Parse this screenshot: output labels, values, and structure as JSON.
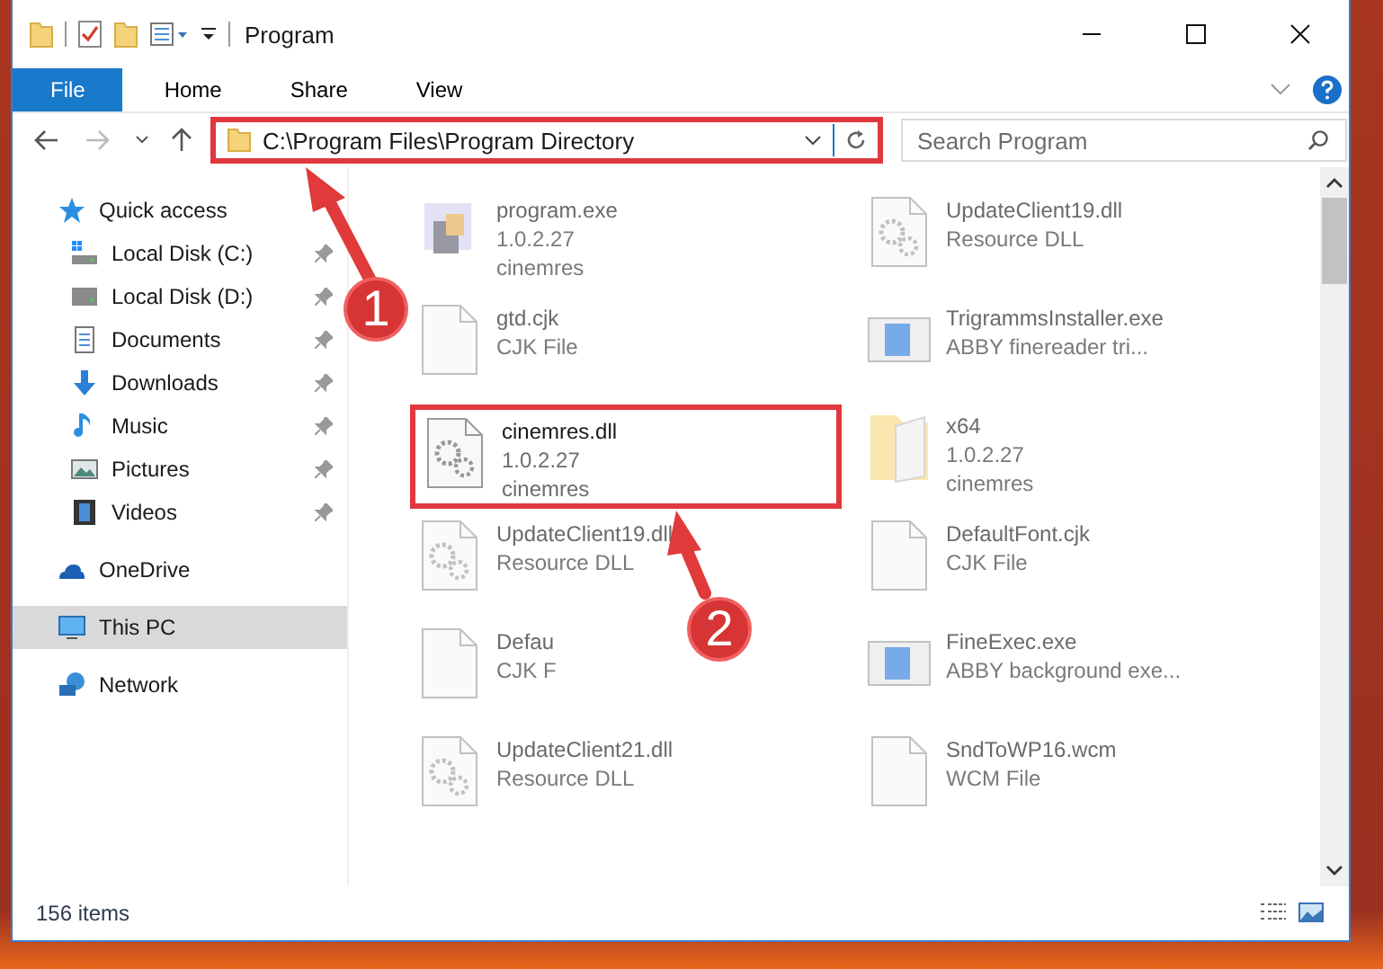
{
  "window": {
    "title": "Program"
  },
  "ribbon_tabs": [
    {
      "label": "File",
      "kind": "file",
      "selected": false
    },
    {
      "label": "Home",
      "kind": "tab",
      "selected": false
    },
    {
      "label": "Share",
      "kind": "tab",
      "selected": false
    },
    {
      "label": "View",
      "kind": "tab",
      "selected": false
    }
  ],
  "address_bar": {
    "path": "C:\\Program Files\\Program Directory",
    "highlighted": true
  },
  "search": {
    "placeholder": "Search Program"
  },
  "sidebar": {
    "items": [
      {
        "label": "Quick access",
        "kind": "star",
        "pinned": false,
        "selected": false,
        "children": [
          {
            "label": "Local Disk (C:)",
            "kind": "system-drive",
            "pinned": true,
            "selected": false
          },
          {
            "label": "Local Disk (D:)",
            "kind": "drive",
            "pinned": true,
            "selected": false
          },
          {
            "label": "Documents",
            "kind": "documents",
            "pinned": true,
            "selected": false
          },
          {
            "label": "Downloads",
            "kind": "downloads",
            "pinned": true,
            "selected": false
          },
          {
            "label": "Music",
            "kind": "music",
            "pinned": true,
            "selected": false
          },
          {
            "label": "Pictures",
            "kind": "pictures",
            "pinned": true,
            "selected": false
          },
          {
            "label": "Videos",
            "kind": "videos",
            "pinned": true,
            "selected": false
          }
        ]
      },
      {
        "label": "OneDrive",
        "kind": "cloud",
        "pinned": false,
        "selected": false
      },
      {
        "label": "This PC",
        "kind": "pc",
        "pinned": false,
        "selected": true
      },
      {
        "label": "Network",
        "kind": "network",
        "pinned": false,
        "selected": false
      }
    ]
  },
  "files": [
    {
      "name": "program.exe",
      "details": [
        "1.0.2.27",
        "cinemres"
      ],
      "kind": "app",
      "blurred": true,
      "highlighted": false
    },
    {
      "name": "UpdateClient19.dll",
      "details": [
        "Resource DLL"
      ],
      "kind": "dll",
      "blurred": true,
      "highlighted": false
    },
    {
      "name": "gtd.cjk",
      "details": [
        "CJK File"
      ],
      "kind": "blank",
      "blurred": true,
      "highlighted": false
    },
    {
      "name": "TrigrammsInstaller.exe",
      "details": [
        "ABBY finereader tri..."
      ],
      "kind": "window",
      "blurred": true,
      "highlighted": false
    },
    {
      "name": "cinemres.dll",
      "details": [
        "1.0.2.27",
        "cinemres"
      ],
      "kind": "dll",
      "blurred": false,
      "highlighted": true
    },
    {
      "name": "x64",
      "details": [
        "1.0.2.27",
        "cinemres"
      ],
      "kind": "folder",
      "blurred": true,
      "highlighted": false
    },
    {
      "name": "UpdateClient19.dll",
      "details": [
        "Resource DLL"
      ],
      "kind": "dll",
      "blurred": true,
      "highlighted": false
    },
    {
      "name": "DefaultFont.cjk",
      "details": [
        "CJK File"
      ],
      "kind": "blank",
      "blurred": true,
      "highlighted": false
    },
    {
      "name": "Defau",
      "details": [
        "CJK F"
      ],
      "kind": "blank",
      "blurred": true,
      "highlighted": false
    },
    {
      "name": "FineExec.exe",
      "details": [
        "ABBY background exe..."
      ],
      "kind": "window",
      "blurred": true,
      "highlighted": false
    },
    {
      "name": "UpdateClient21.dll",
      "details": [
        "Resource DLL"
      ],
      "kind": "dll",
      "blurred": true,
      "highlighted": false
    },
    {
      "name": "SndToWP16.wcm",
      "details": [
        "WCM File"
      ],
      "kind": "blank",
      "blurred": true,
      "highlighted": false
    }
  ],
  "status_bar": {
    "item_count": "156 items"
  },
  "annotations": [
    {
      "label": "1"
    },
    {
      "label": "2"
    }
  ]
}
